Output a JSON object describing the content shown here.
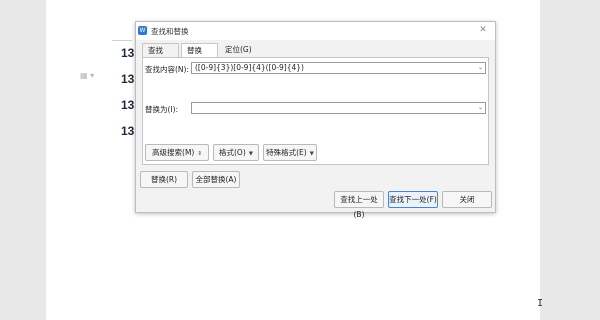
{
  "document": {
    "numbers": [
      "13",
      "13",
      "13",
      "13"
    ]
  },
  "dialog": {
    "title": "查找和替换",
    "tabs": [
      {
        "label": "查找(D)",
        "active": false
      },
      {
        "label": "替换(P)",
        "active": true
      },
      {
        "label": "定位(G)",
        "active": false
      }
    ],
    "find_label": "查找内容(N):",
    "find_value": "([0-9]{3})[0-9]{4}([0-9]{4})",
    "replace_label": "替换为(I):",
    "replace_value": "",
    "options_buttons": {
      "advanced": "高级搜索(M)",
      "format": "格式(O)",
      "special": "特殊格式(E)"
    },
    "action_buttons": {
      "replace": "替换(R)",
      "replace_all": "全部替换(A)"
    },
    "bottom_buttons": {
      "find_prev": "查找上一处(B)",
      "find_next": "查找下一处(F)",
      "close": "关闭"
    }
  },
  "colors": {
    "accent": "#2b79d0",
    "primary_border": "#4a86c5"
  }
}
